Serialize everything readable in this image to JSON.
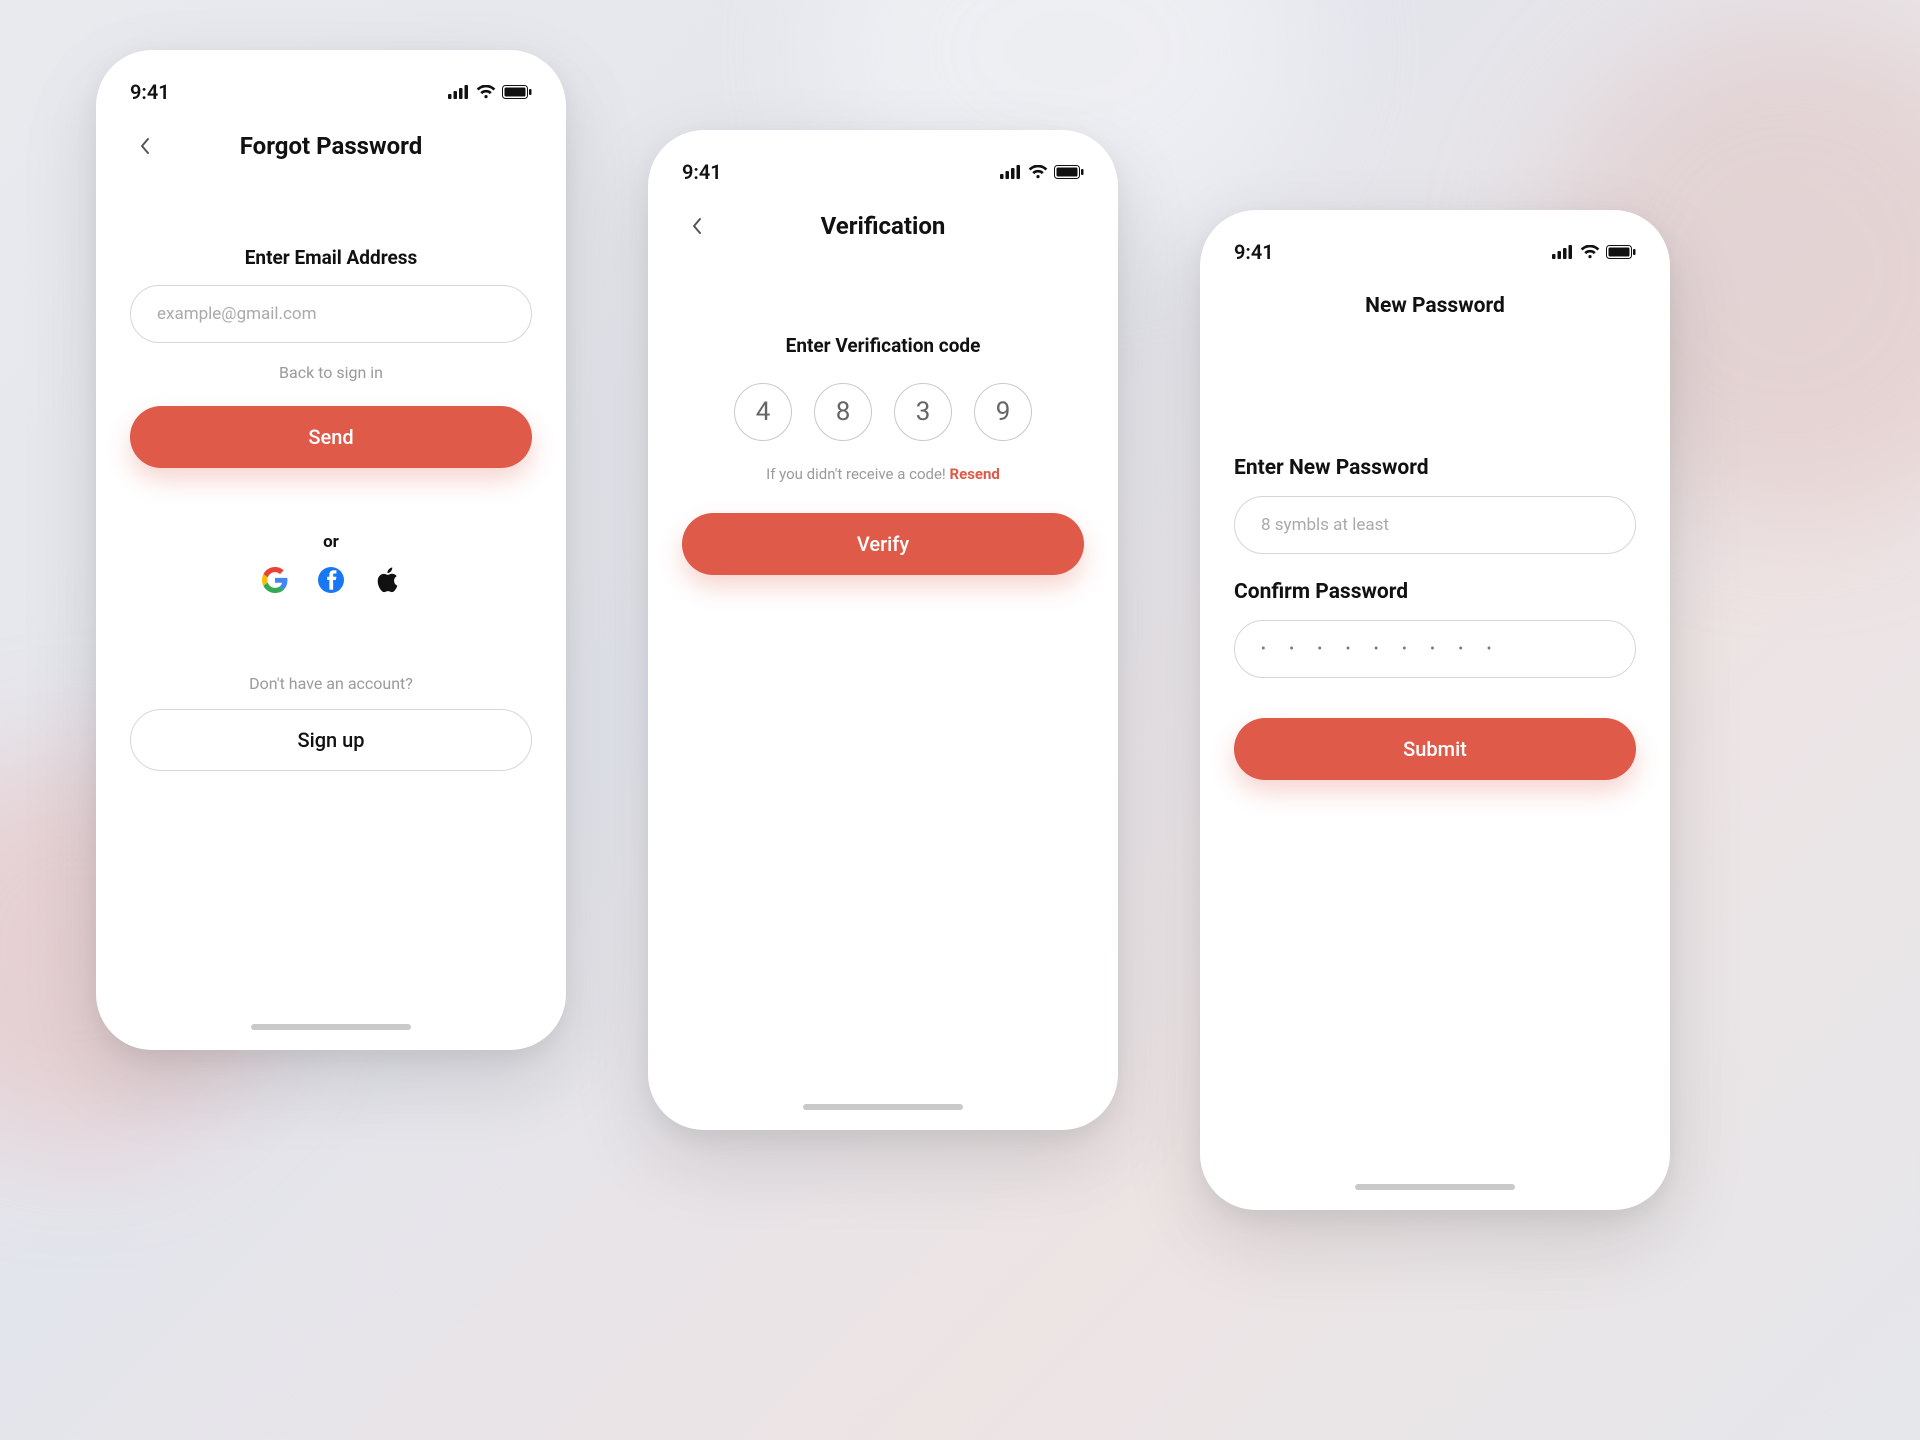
{
  "status": {
    "time": "9:41"
  },
  "forgot": {
    "title": "Forgot Password",
    "email_label": "Enter Email Address",
    "email_placeholder": "example@gmail.com",
    "back_link": "Back to sign in",
    "send_label": "Send",
    "or_label": "or",
    "no_account": "Don't have an account?",
    "signup_label": "Sign up"
  },
  "verify": {
    "title": "Verification",
    "code_label": "Enter  Verification code",
    "digits": [
      "4",
      "8",
      "3",
      "9"
    ],
    "no_code_text": "If you didn't receive a code! ",
    "resend_label": "Resend",
    "verify_label": "Verify"
  },
  "newpw": {
    "title": "New Password",
    "new_label": "Enter New Password",
    "new_placeholder": "8 symbls at least",
    "confirm_label": "Confirm Password",
    "confirm_value": "• • • • • • • • •",
    "submit_label": "Submit"
  }
}
